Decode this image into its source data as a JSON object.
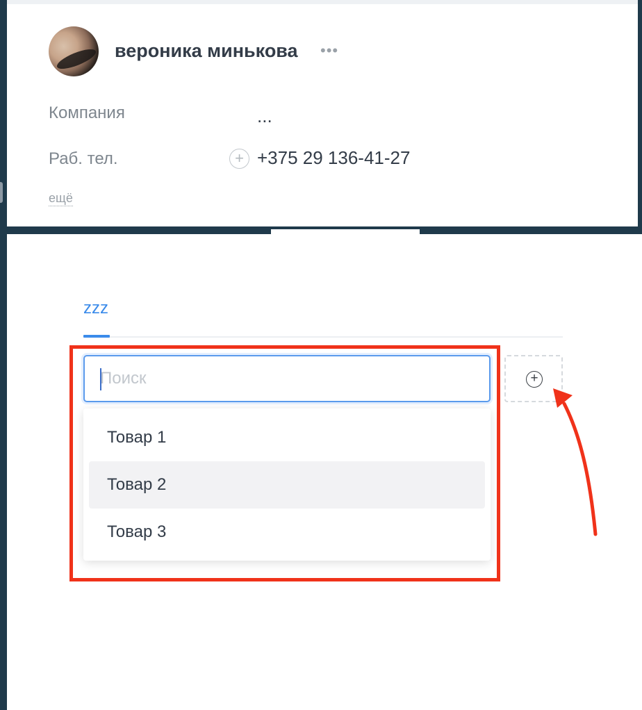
{
  "contact": {
    "name": "вероника минькова",
    "more_icon": "more-dots-icon"
  },
  "fields": [
    {
      "label": "Компания",
      "value": "..."
    },
    {
      "label": "Раб. тел.",
      "value": "+375 29 136-41-27"
    }
  ],
  "more_link": "ещё",
  "tabs": [
    {
      "label": "zzz",
      "active": true
    }
  ],
  "search": {
    "placeholder": "Поиск",
    "value": ""
  },
  "add_button_icon": "plus-circle-icon",
  "dropdown": {
    "items": [
      "Товар 1",
      "Товар 2",
      "Товар 3"
    ],
    "hovered_index": 1
  },
  "colors": {
    "accent": "#3b8bea",
    "annotation": "#f0321a",
    "frame": "#1f3a4b"
  }
}
